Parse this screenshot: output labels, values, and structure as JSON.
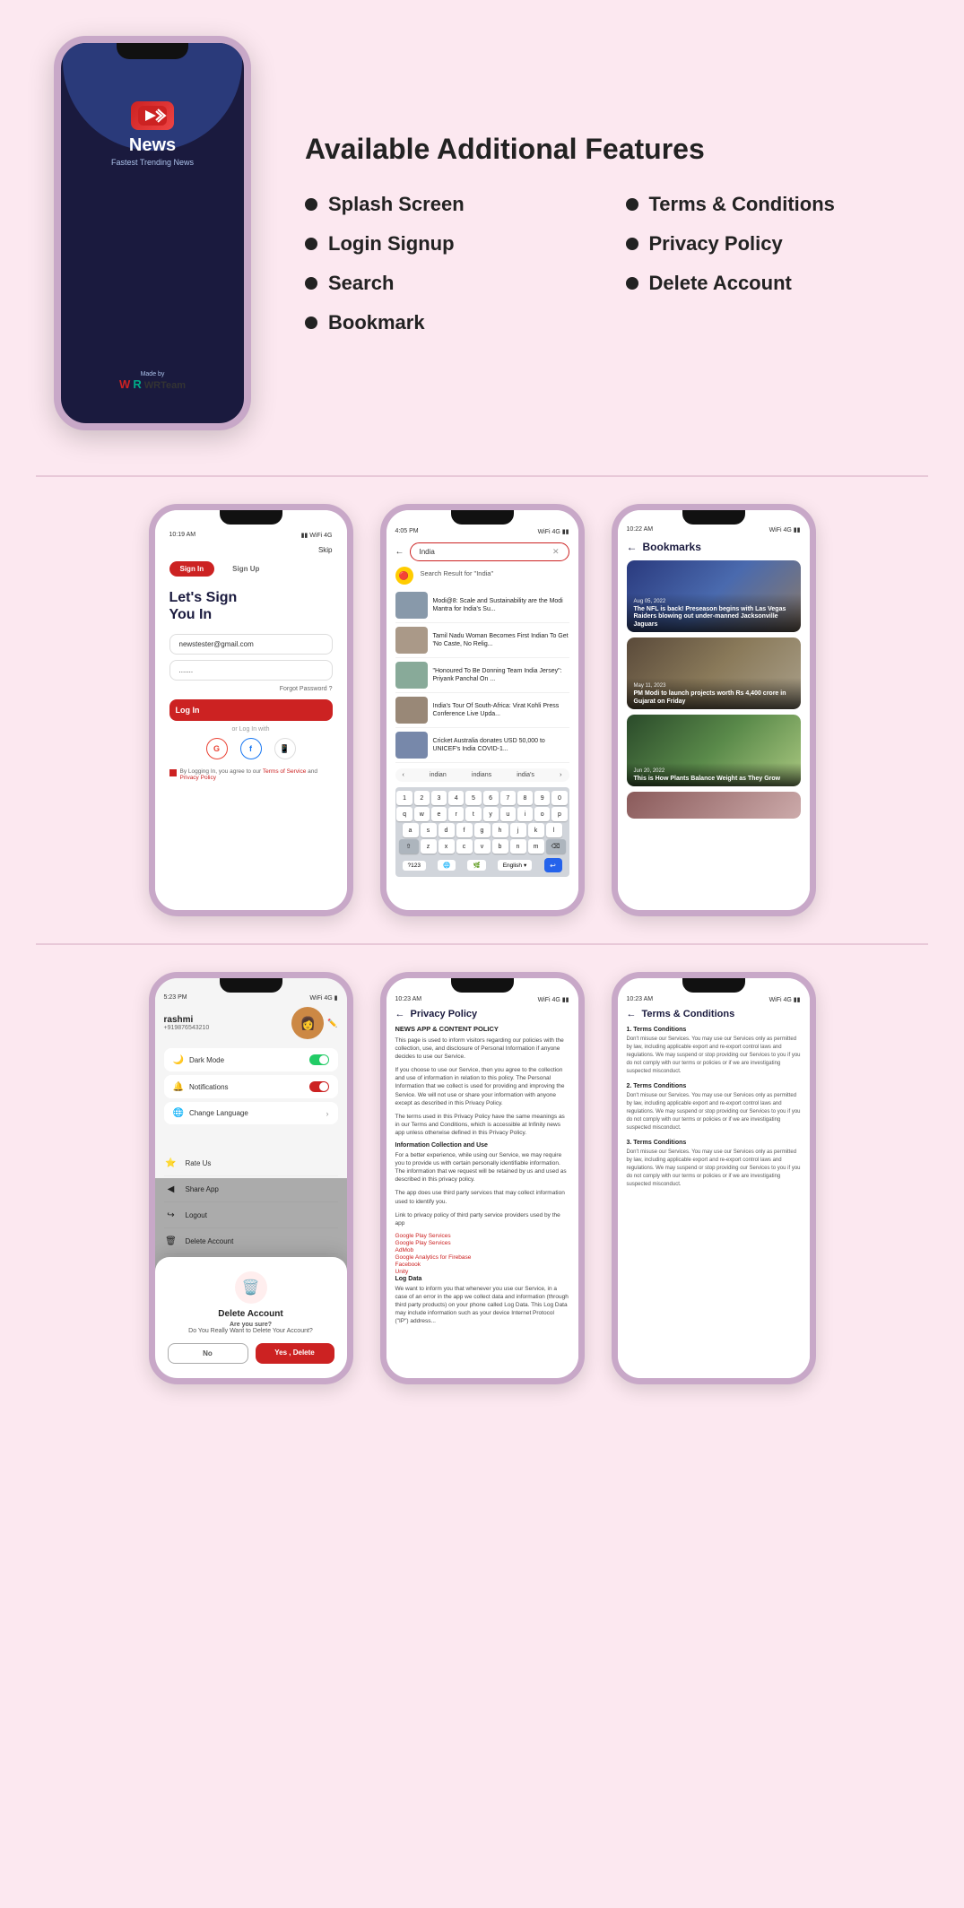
{
  "hero": {
    "title": "Available Additional Features",
    "app_name": "News",
    "app_subtitle": "Fastest Trending News",
    "made_by": "Made by",
    "wr_team": "WRTeam",
    "features": [
      {
        "label": "Splash Screen"
      },
      {
        "label": "Terms & Conditions"
      },
      {
        "label": "Login Signup"
      },
      {
        "label": "Privacy Policy"
      },
      {
        "label": "Search"
      },
      {
        "label": "Delete Account"
      },
      {
        "label": "Bookmark"
      }
    ]
  },
  "phone_login": {
    "status_time": "10:19 AM",
    "skip": "Skip",
    "tab_signin": "Sign In",
    "tab_signup": "Sign Up",
    "heading": "Let's Sign\nYou In",
    "email_placeholder": "newstester@gmail.com",
    "password_placeholder": ".......",
    "forgot_password": "Forgot Password ?",
    "login_button": "Log In",
    "or_text": "or Log In with",
    "google": "G",
    "facebook": "f",
    "phone_icon": "📱",
    "terms_note": "By Logging In, you agree to our",
    "terms_link": "Terms of Service",
    "and": "and",
    "privacy_link": "Privacy Policy"
  },
  "phone_search": {
    "status_time": "4:05 PM",
    "search_query": "India",
    "result_label": "Search Result for \"India\"",
    "results": [
      {
        "text": "Modi@8: Scale and Sustainability are the Modi Mantra for India's Su..."
      },
      {
        "text": "Tamil Nadu Woman Becomes First Indian To Get 'No Caste, No Relig..."
      },
      {
        "text": "\"Honoured To Be Donning Team India Jersey\": Priyank Panchal On ..."
      },
      {
        "text": "India's Tour Of South-Africa: Virat Kohli Press Conference Live Upda..."
      },
      {
        "text": "Cricket Australia donates USD 50,000 to UNICEF's India COVID-1..."
      }
    ],
    "suggestions": [
      "indian",
      "indians",
      "india's"
    ],
    "keyboard_rows": [
      [
        "q",
        "w",
        "e",
        "r",
        "t",
        "y",
        "u",
        "i",
        "o",
        "p"
      ],
      [
        "a",
        "s",
        "d",
        "f",
        "g",
        "h",
        "j",
        "k",
        "l"
      ],
      [
        "⇧",
        "z",
        "x",
        "c",
        "v",
        "b",
        "n",
        "m",
        "⌫"
      ]
    ],
    "keyboard_bottom": [
      "?123",
      "🌐",
      "space",
      "English",
      "↩"
    ],
    "lang": "English"
  },
  "phone_bookmarks": {
    "status_time": "10:22 AM",
    "header": "Bookmarks",
    "cards": [
      {
        "date": "Aug 05, 2022",
        "title": "The NFL is back! Preseason begins with Las Vegas Raiders blowing out under-manned Jacksonville Jaguars"
      },
      {
        "date": "May 11, 2023",
        "title": "PM Modi to launch projects worth Rs 4,400 crore in Gujarat on Friday"
      },
      {
        "date": "Jun 20, 2022",
        "title": "This is How Plants Balance Weight as They Grow"
      }
    ]
  },
  "phone_profile": {
    "status_time": "5:23 PM",
    "username": "rashmi",
    "phone": "+919876543210",
    "settings": [
      {
        "label": "Dark Mode",
        "toggle": "on"
      },
      {
        "label": "Notifications",
        "toggle": "off"
      },
      {
        "label": "Change Language",
        "toggle": null
      }
    ],
    "delete_modal": {
      "title": "Delete Account",
      "confirm_text": "Are you sure?",
      "sub_text": "Do You Really Want to Delete Your Account?",
      "btn_no": "No",
      "btn_yes": "Yes , Delete"
    },
    "bottom_menu": [
      {
        "icon": "⭐",
        "label": "Rate Us"
      },
      {
        "icon": "◀",
        "label": "Share App"
      },
      {
        "icon": "↪",
        "label": "Logout"
      },
      {
        "icon": "🗑",
        "label": "Delete Account"
      }
    ]
  },
  "phone_privacy": {
    "status_time": "10:23 AM",
    "header": "Privacy Policy",
    "subtitle": "NEWS APP & CONTENT POLICY",
    "paragraphs": [
      "This page is used to inform visitors regarding our policies with the collection, use, and disclosure of Personal Information if anyone decides to use our Service.",
      "If you choose to use our Service, then you agree to the collection and use of information in relation to this policy. The Personal Information that we collect is used for providing and improving the Service. We will not use or share your information with anyone except as described in this Privacy Policy.",
      "The terms used in this Privacy Policy have the same meanings as in our Terms and Conditions, which is accessible at Infinity news app unless otherwise defined in this Privacy Policy."
    ],
    "info_section": "Information Collection and Use",
    "info_text": "For a better experience, while using our Service, we may require you to provide us with certain personally identifiable information. The information that we request will be retained by us and used as described in this privacy policy.",
    "third_party_text": "The app does use third party services that may collect information used to identify you.",
    "link_text": "Link to privacy policy of third party service providers used by the app",
    "links": [
      "Google Play Services",
      "AdMob",
      "Google Analytics for Firebase",
      "Facebook",
      "Unity"
    ],
    "log_section": "Log Data",
    "log_text": "We want to inform you that whenever you use our Service, in a case of an error in the app we collect data and information (through third party products) on your phone called Log Data. This Log Data may include information such as your device Internet Protocol (\"IP\") address..."
  },
  "phone_terms": {
    "status_time": "10:23 AM",
    "header": "Terms & Conditions",
    "sections": [
      {
        "title": "1. Terms Conditions",
        "text": "Don't misuse our Services. You may use our Services only as permitted by law, including applicable export and re-export control laws and regulations. We may suspend or stop providing our Services to you if you do not comply with our terms or policies or if we are investigating suspected misconduct."
      },
      {
        "title": "2. Terms Conditions",
        "text": "Don't misuse our Services. You may use our Services only as permitted by law, including applicable export and re-export control laws and regulations. We may suspend or stop providing our Services to you if you do not comply with our terms or policies or if we are investigating suspected misconduct."
      },
      {
        "title": "3. Terms Conditions",
        "text": "Don't misuse our Services. You may use our Services only as permitted by law, including applicable export and re-export control laws and regulations. We may suspend or stop providing our Services to you if you do not comply with our terms or policies or if we are investigating suspected misconduct."
      }
    ]
  },
  "colors": {
    "accent": "#cc2222",
    "dark_blue": "#1a1a3e",
    "pink_bg": "#fce8f0",
    "border_pink": "#c8a8c8"
  }
}
